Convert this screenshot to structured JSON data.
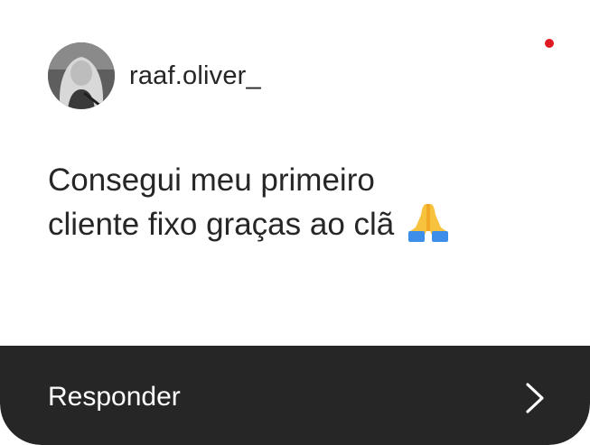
{
  "header": {
    "username": "raaf.oliver_",
    "avatar_icon": "profile-photo-avatar"
  },
  "notification": {
    "dot_color": "#e01b24"
  },
  "message": {
    "line1": "Consegui meu primeiro",
    "line2": "cliente fixo graças ao clã",
    "emoji": "folded-hands-emoji"
  },
  "reply": {
    "label": "Responder",
    "icon": "chevron-right-icon",
    "bar_color": "#262626"
  }
}
